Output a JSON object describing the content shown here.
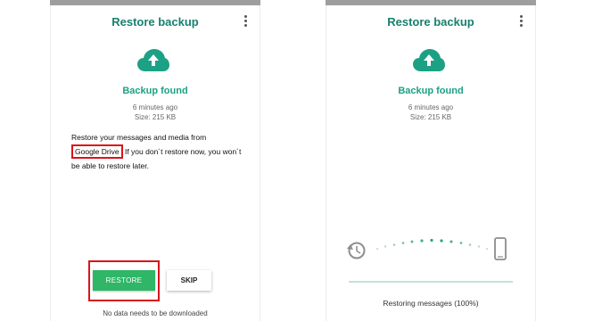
{
  "left_screen": {
    "title": "Restore backup",
    "status": "Backup found",
    "time_ago": "6 minutes ago",
    "size": "Size: 215 KB",
    "description_part1": "Restore your messages and media from",
    "description_highlight": "Google Drive",
    "description_part2": " If you don´t restore now, you won´t be able to restore later.",
    "restore_button": "RESTORE",
    "skip_button": "SKIP",
    "footer_note": "No data needs to be downloaded"
  },
  "right_screen": {
    "title": "Restore backup",
    "status": "Backup found",
    "time_ago": "6 minutes ago",
    "size": "Size: 215 KB",
    "progress_text": "Restoring messages (100%)",
    "progress_value": 1.0
  },
  "icons": {
    "cloud": "cloud-upload-icon",
    "menu": "more-vert-icon",
    "history": "history-icon",
    "phone": "smartphone-icon"
  },
  "colors": {
    "title": "#18806e",
    "accent": "#1da185",
    "restore_button": "#2fb666",
    "highlight_border": "#d9141c"
  }
}
